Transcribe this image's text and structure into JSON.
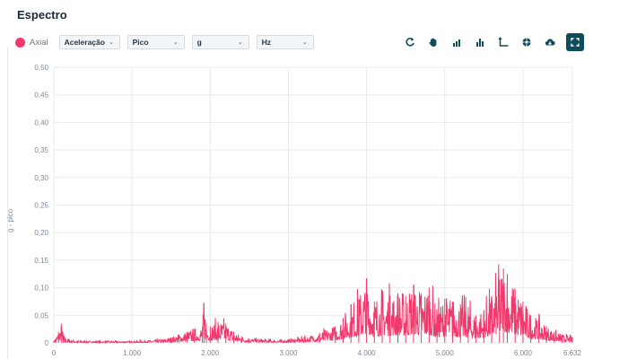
{
  "panel": {
    "title": "Espectro"
  },
  "legend": {
    "label": "Axial",
    "color": "#f03a6d"
  },
  "controls": {
    "measure": "Aceleração",
    "statistic": "Pico",
    "unit": "g",
    "freq_unit": "Hz"
  },
  "toolbar": {
    "icons": [
      "refresh-icon",
      "pan-hand-icon",
      "bar-chart-icon",
      "bar-chart-alt-icon",
      "axis-icon",
      "settings-dial-icon",
      "cloud-download-icon",
      "fullscreen-icon"
    ]
  },
  "chart_data": {
    "type": "line",
    "title": "",
    "xlabel": "",
    "ylabel": "g - pico",
    "xlim": [
      0,
      6632
    ],
    "ylim": [
      0,
      0.5
    ],
    "x_ticks": [
      0,
      1000,
      2000,
      3000,
      4000,
      5000,
      6000,
      6632
    ],
    "x_tick_labels": [
      "0",
      "1.000",
      "2.000",
      "3.000",
      "4.000",
      "5.000",
      "6.000",
      "6.632"
    ],
    "y_ticks": [
      0,
      0.05,
      0.1,
      0.15,
      0.2,
      0.25,
      0.3,
      0.35,
      0.4,
      0.45,
      0.5
    ],
    "y_tick_labels": [
      "0",
      "0,05",
      "0,10",
      "0,15",
      "0,20",
      "0,25",
      "0,30",
      "0,35",
      "0,40",
      "0,45",
      "0,50"
    ],
    "grid": true,
    "series": [
      {
        "name": "Axial",
        "color": "#f03a6d",
        "x": [
          0,
          60,
          100,
          120,
          140,
          200,
          300,
          500,
          800,
          1000,
          1200,
          1400,
          1500,
          1600,
          1700,
          1800,
          1900,
          1920,
          1950,
          2000,
          2100,
          2200,
          2300,
          2400,
          2500,
          2700,
          2900,
          3000,
          3200,
          3400,
          3600,
          3700,
          3800,
          3900,
          4000,
          4100,
          4200,
          4300,
          4400,
          4500,
          4600,
          4700,
          4800,
          4900,
          5000,
          5100,
          5200,
          5300,
          5400,
          5500,
          5600,
          5700,
          5750,
          5800,
          5900,
          6000,
          6100,
          6200,
          6300,
          6400,
          6500,
          6632
        ],
        "y": [
          0.003,
          0.02,
          0.035,
          0.015,
          0.01,
          0.006,
          0.004,
          0.003,
          0.003,
          0.003,
          0.004,
          0.006,
          0.01,
          0.015,
          0.02,
          0.025,
          0.03,
          0.073,
          0.035,
          0.03,
          0.038,
          0.035,
          0.02,
          0.012,
          0.008,
          0.006,
          0.005,
          0.006,
          0.01,
          0.018,
          0.03,
          0.045,
          0.07,
          0.08,
          0.115,
          0.075,
          0.095,
          0.085,
          0.09,
          0.085,
          0.105,
          0.09,
          0.1,
          0.06,
          0.08,
          0.075,
          0.07,
          0.065,
          0.05,
          0.06,
          0.085,
          0.115,
          0.135,
          0.125,
          0.095,
          0.075,
          0.05,
          0.04,
          0.03,
          0.02,
          0.015,
          0.01
        ]
      }
    ]
  }
}
